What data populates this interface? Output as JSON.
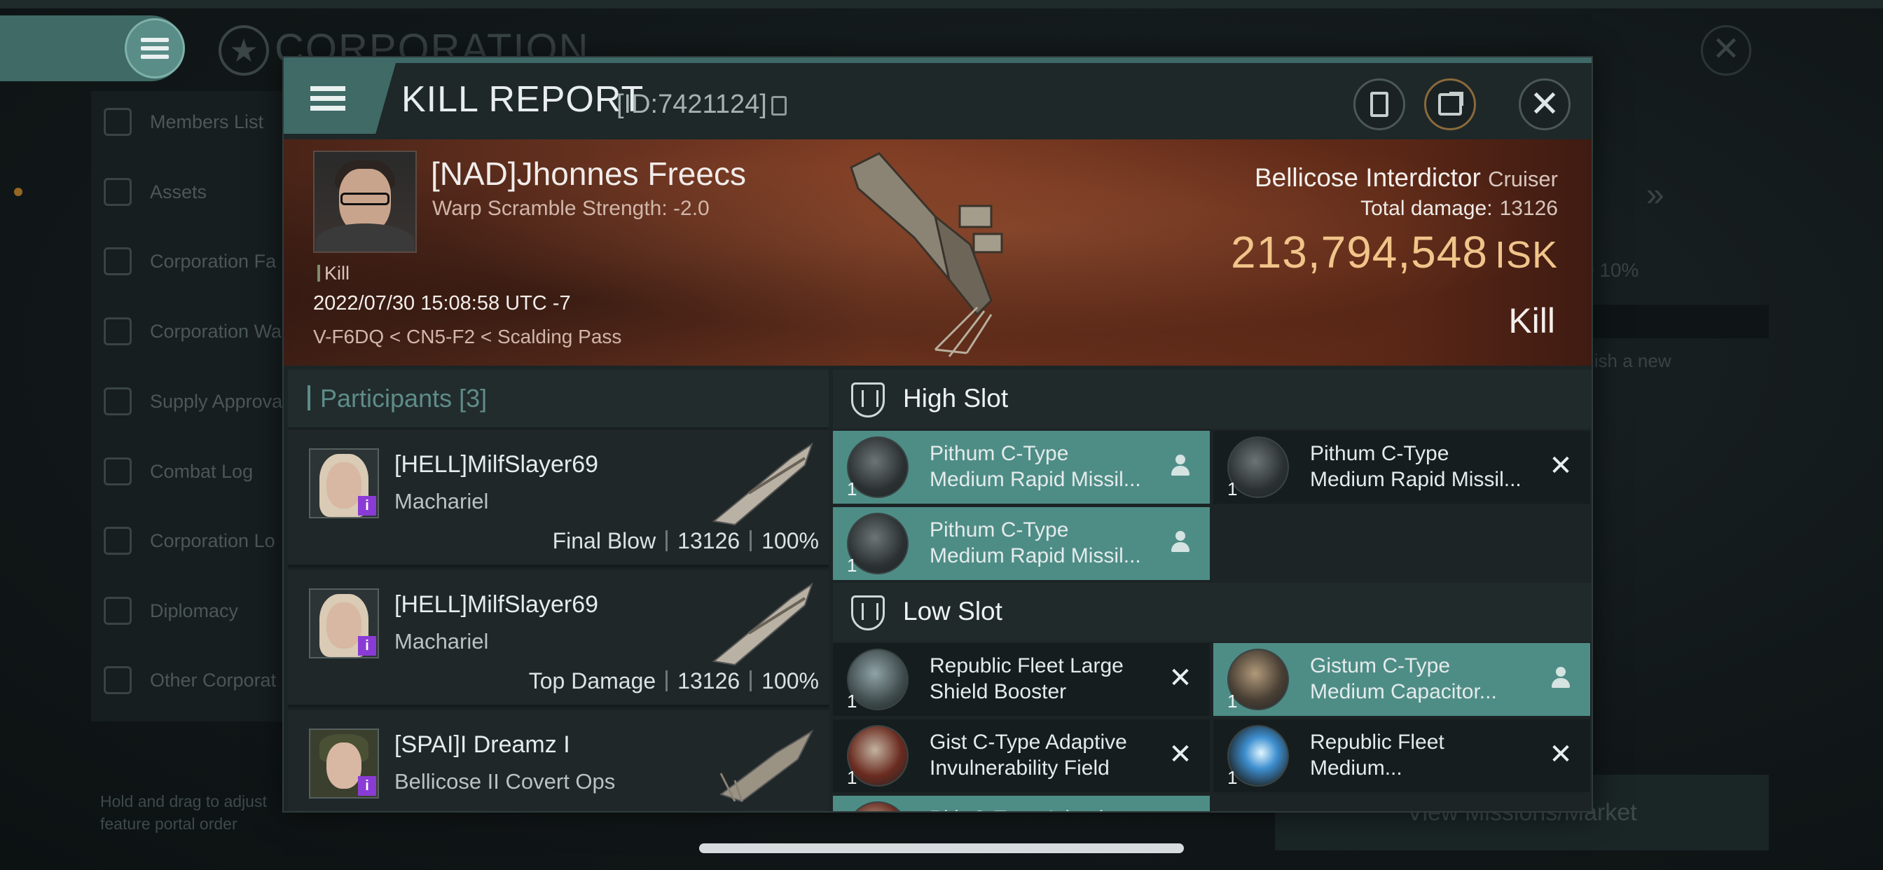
{
  "background": {
    "title": "CORPORATION",
    "sidebar_items": [
      "Members List",
      "Assets",
      "Corporation Fa",
      "Corporation Wa",
      "Supply Approva",
      "Combat Log",
      "Corporation Lo",
      "Diplomacy",
      "Other Corporat"
    ],
    "hint": "Hold and drag to adjust feature portal order",
    "right_text": "lish a new",
    "right_button": "View Missions/Market",
    "right_fields": "0     10%"
  },
  "header": {
    "title": "KILL REPORT",
    "report_id": "[ID:7421124]"
  },
  "victim": {
    "name": "[NAD]Jhonnes Freecs",
    "warp_scramble": "Warp Scramble Strength: -2.0",
    "tag": "Kill",
    "datetime": "2022/07/30 15:08:58 UTC -7",
    "location": "V-F6DQ < CN5-F2 < Scalding Pass",
    "ship": "Bellicose Interdictor",
    "ship_class": "Cruiser",
    "total_damage_label": "Total damage:",
    "total_damage": "13126",
    "isk_value": "213,794,548",
    "isk_unit": "ISK",
    "result": "Kill"
  },
  "participants": {
    "title": "Participants [3]",
    "rows": [
      {
        "name": "[HELL]MilfSlayer69",
        "ship": "Machariel",
        "role": "Final Blow",
        "damage": "13126",
        "percent": "100%"
      },
      {
        "name": "[HELL]MilfSlayer69",
        "ship": "Machariel",
        "role": "Top Damage",
        "damage": "13126",
        "percent": "100%"
      },
      {
        "name": "[SPAI]I Dreamz I",
        "ship": "Bellicose II Covert Ops",
        "role": "",
        "damage": "",
        "percent": ""
      }
    ]
  },
  "fitting": {
    "high_slot_label": "High Slot",
    "low_slot_label": "Low Slot",
    "high": [
      {
        "qty": "1",
        "line1": "Pithum C-Type",
        "line2": "Medium Rapid Missil...",
        "status": "dropped",
        "icon": "missile-launcher-icon"
      },
      {
        "qty": "1",
        "line1": "Pithum C-Type",
        "line2": "Medium Rapid Missil...",
        "status": "destroyed",
        "icon": "missile-launcher-icon"
      },
      {
        "qty": "1",
        "line1": "Pithum C-Type",
        "line2": "Medium Rapid Missil...",
        "status": "dropped",
        "icon": "missile-launcher-icon"
      }
    ],
    "low": [
      {
        "qty": "1",
        "line1": "Republic Fleet Large",
        "line2": "Shield Booster",
        "status": "destroyed",
        "icon": "shield-booster-icon"
      },
      {
        "qty": "1",
        "line1": "Gistum C-Type",
        "line2": "Medium Capacitor...",
        "status": "dropped",
        "icon": "capacitor-booster-icon"
      },
      {
        "qty": "1",
        "line1": "Gist C-Type Adaptive",
        "line2": "Invulnerability Field",
        "status": "destroyed",
        "icon": "invulnerability-field-icon"
      },
      {
        "qty": "1",
        "line1": "Republic Fleet",
        "line2": "Medium...",
        "status": "destroyed",
        "icon": "shield-extender-icon"
      },
      {
        "qty": "",
        "line1": "Pith C-Type Adaptive",
        "line2": "",
        "status": "dropped",
        "icon": "invulnerability-field-icon"
      }
    ]
  },
  "colors": {
    "accent": "#3f6a66",
    "dropped_row": "#4e8d86",
    "isk_gold": "#f1c48a",
    "banner": "#6a3320"
  }
}
